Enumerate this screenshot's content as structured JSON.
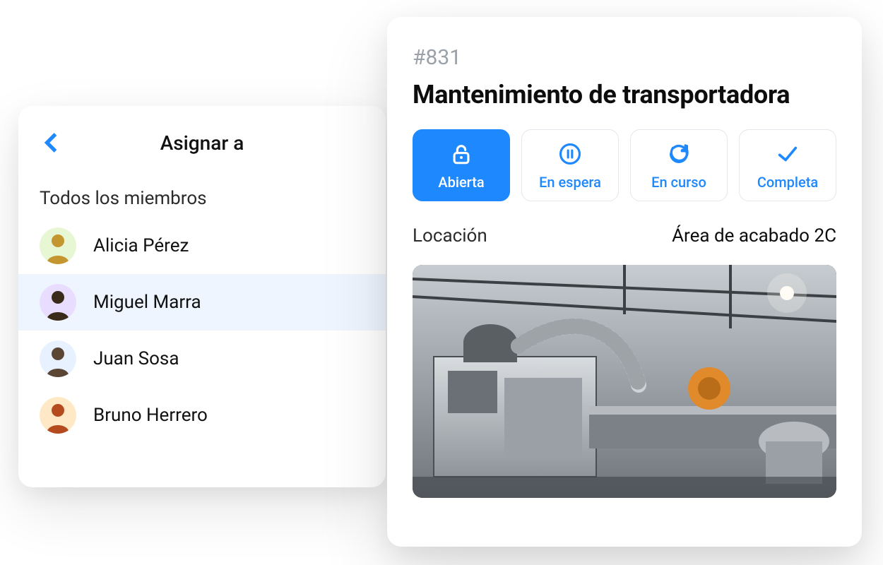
{
  "assign": {
    "title": "Asignar a",
    "section_label": "Todos los miembros",
    "members": [
      {
        "name": "Alicia Pérez",
        "avatar_bg": "#e8f7d3",
        "avatar_fg": "#c4962f",
        "selected": false
      },
      {
        "name": "Miguel Marra",
        "avatar_bg": "#e9ddff",
        "avatar_fg": "#3a2a1a",
        "selected": true
      },
      {
        "name": "Juan Sosa",
        "avatar_bg": "#e7f1ff",
        "avatar_fg": "#5b4636",
        "selected": false
      },
      {
        "name": "Bruno Herrero",
        "avatar_bg": "#ffe8c6",
        "avatar_fg": "#b54a1e",
        "selected": false
      }
    ]
  },
  "task": {
    "id_label": "#831",
    "title": "Mantenimiento de transportadora",
    "statuses": [
      {
        "key": "open",
        "label": "Abierta",
        "icon": "unlock-icon",
        "active": true
      },
      {
        "key": "onhold",
        "label": "En espera",
        "icon": "pause-icon",
        "active": false
      },
      {
        "key": "inprogress",
        "label": "En curso",
        "icon": "refresh-icon",
        "active": false
      },
      {
        "key": "done",
        "label": "Completa",
        "icon": "check-icon",
        "active": false
      }
    ],
    "location_label": "Locación",
    "location_value": "Área de acabado 2C",
    "photo_alt": "industrial-conveyor-photo"
  },
  "colors": {
    "accent": "#1e88ff"
  }
}
